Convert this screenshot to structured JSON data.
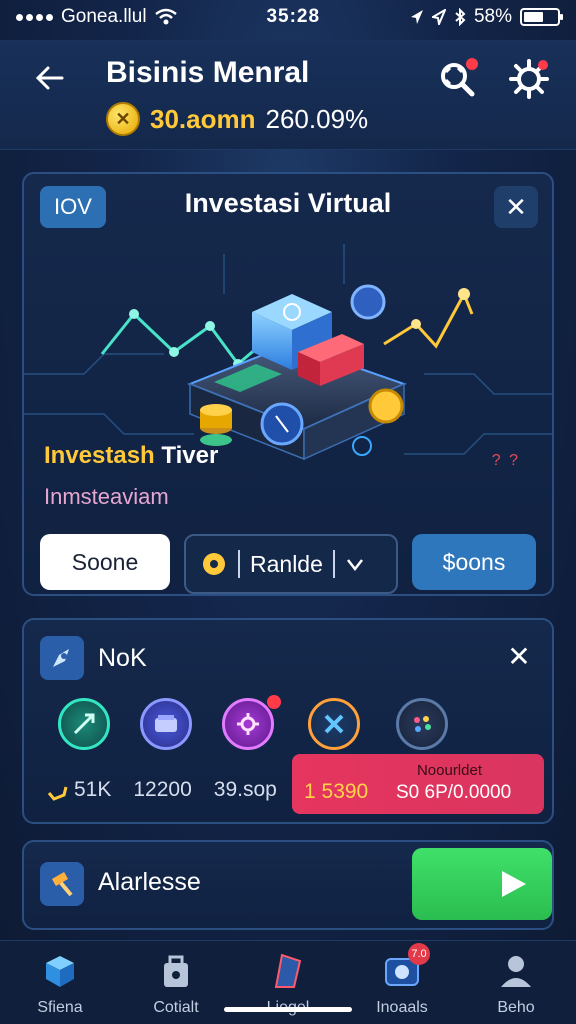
{
  "status_bar": {
    "carrier": "Gonea.llul",
    "time": "35:28",
    "battery_percent": "58%",
    "battery_level": 0.58
  },
  "header": {
    "title": "Bisinis Menral",
    "balance_amount": "30.aomn",
    "balance_percent": "260.09%"
  },
  "hero_card": {
    "tag": "IOV",
    "title": "Investasi Virtual",
    "subtitle_1_highlight": "Investash",
    "subtitle_1_rest": "Tiver",
    "subtitle_2": "Inmsteaviam",
    "dots": "? ?",
    "btn_left": "Soone",
    "btn_middle": "Ranlde",
    "btn_right": "$oons"
  },
  "stats_card": {
    "title": "NoK",
    "values": [
      "51K",
      "12200",
      "39.sop"
    ],
    "promo_label": "Noourldet",
    "promo_value_1": "1 5390",
    "promo_value_2": "S0 6P/0.0000"
  },
  "alert_card": {
    "title": "Alarlesse"
  },
  "bottom_nav": {
    "items": [
      {
        "label": "Sfiena"
      },
      {
        "label": "Cotialt"
      },
      {
        "label": "Liegel"
      },
      {
        "label": "Inoaals",
        "badge": "7.0"
      },
      {
        "label": "Beho"
      }
    ]
  },
  "colors": {
    "accent_yellow": "#ffc93a",
    "accent_blue": "#2f77bd",
    "accent_green": "#3fe06a",
    "accent_red": "#e6355e"
  },
  "icons": {
    "back": "arrow-left-icon",
    "search_alert": "search-alert-icon",
    "settings": "gear-icon",
    "coin": "coin-icon"
  }
}
